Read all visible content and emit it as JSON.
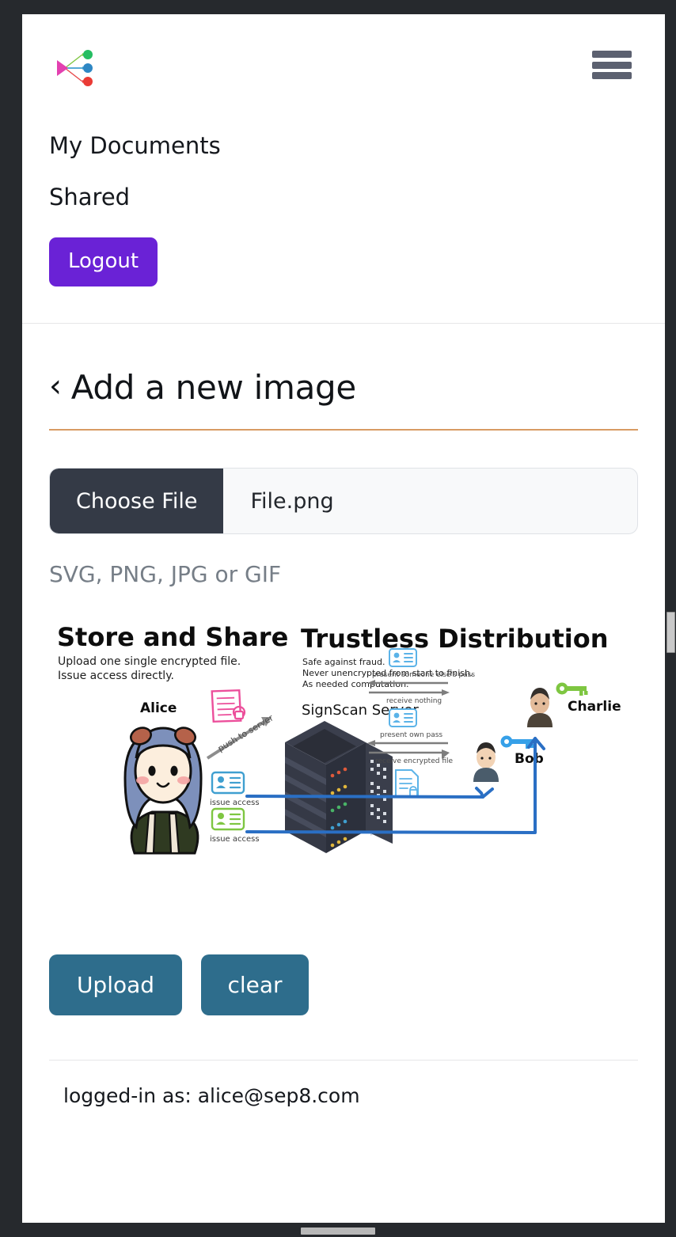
{
  "app": {
    "logo_icon": "share-nodes-icon",
    "menu_icon": "hamburger-menu-icon"
  },
  "nav": {
    "links": [
      {
        "label": "My Documents",
        "name": "nav-link-my-documents"
      },
      {
        "label": "Shared",
        "name": "nav-link-shared"
      }
    ],
    "logout_label": "Logout",
    "logout_color": "#6a22d6"
  },
  "main": {
    "back_icon": "chevron-left-icon",
    "heading": "Add a new image",
    "rule_color": "#d89b63"
  },
  "file_picker": {
    "choose_label": "Choose File",
    "file_name": "File.png",
    "hint": "SVG, PNG, JPG or GIF",
    "button_color": "#343a46"
  },
  "preview": {
    "alt": "SignScan architecture diagram",
    "left_column": {
      "title": "Store and Share",
      "lines": [
        "Upload one single encrypted file.",
        "Issue access directly."
      ]
    },
    "right_column": {
      "title": "Trustless Distribution",
      "lines": [
        "Safe against fraud.",
        "Never unencrypted from start to finish.",
        "As needed computation."
      ]
    },
    "diagram": {
      "server_label": "SignScan Server",
      "alice_label": "Alice",
      "bob_label": "Bob",
      "charlie_label": "Charlie",
      "push_label": "push to server",
      "issue_access_label_1": "issue access",
      "issue_access_label_2": "issue access",
      "flow_1_request": "present someone else's pass",
      "flow_1_response": "receive nothing",
      "flow_2_request": "present own pass",
      "flow_2_response": "receive encrypted file",
      "bob_key_color": "#36a0e8",
      "charlie_key_color": "#7ec641",
      "arrow_color": "#2a6fc4",
      "doc_color": "#ec4f9b"
    }
  },
  "actions": {
    "upload_label": "Upload",
    "clear_label": "clear",
    "button_color": "#2e6d8c"
  },
  "footer": {
    "status": "logged-in as: alice@sep8.com"
  }
}
